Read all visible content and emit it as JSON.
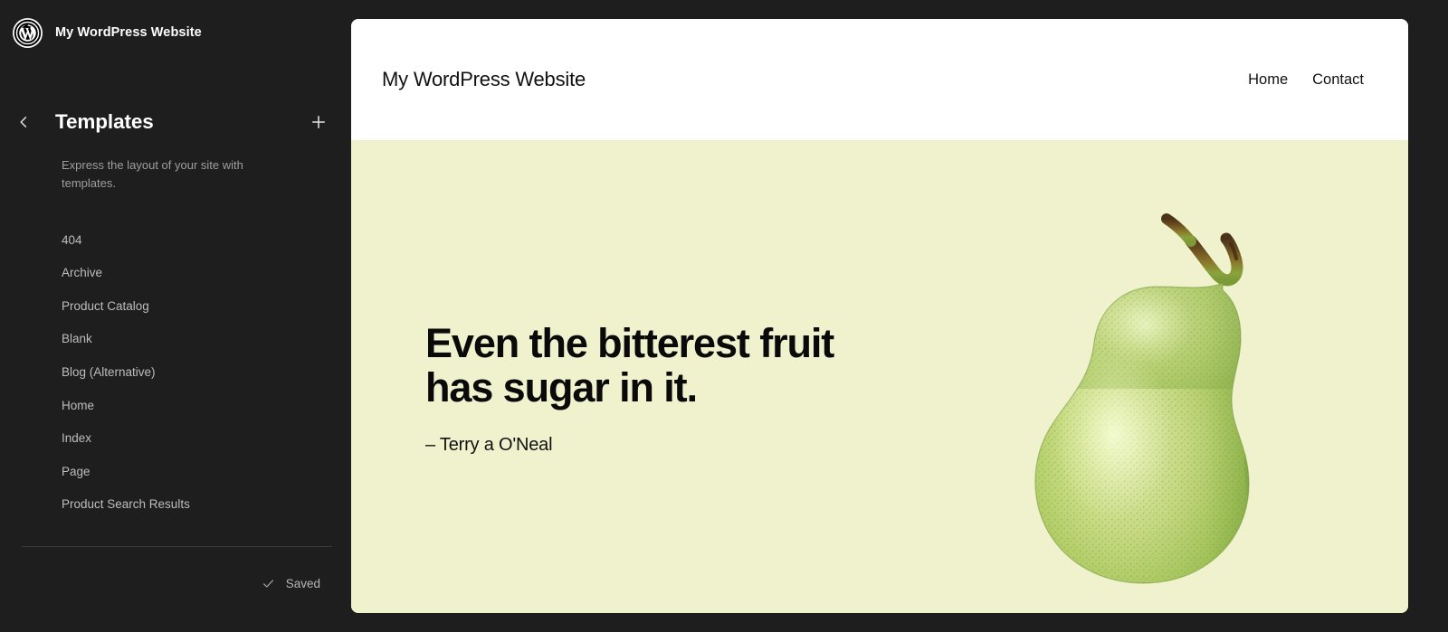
{
  "sidebar": {
    "site_hub": {
      "logo_icon": "wordpress-logo-icon",
      "title": "My WordPress Website"
    },
    "panel": {
      "back_icon": "chevron-left-icon",
      "title": "Templates",
      "add_icon": "plus-icon",
      "description": "Express the layout of your site with templates."
    },
    "templates": [
      {
        "label": "404"
      },
      {
        "label": "Archive"
      },
      {
        "label": "Product Catalog"
      },
      {
        "label": "Blank"
      },
      {
        "label": "Blog (Alternative)"
      },
      {
        "label": "Home"
      },
      {
        "label": "Index"
      },
      {
        "label": "Page"
      },
      {
        "label": "Product Search Results"
      }
    ],
    "save_status": {
      "icon": "check-icon",
      "label": "Saved"
    }
  },
  "canvas": {
    "site_header": {
      "site_title": "My WordPress Website",
      "nav": [
        {
          "label": "Home"
        },
        {
          "label": "Contact"
        }
      ]
    },
    "hero": {
      "quote": "Even the bitterest fruit has sugar in it.",
      "citation": "– Terry a O'Neal",
      "image_icon": "pear-illustration",
      "background_color": "#eff2cd"
    }
  },
  "colors": {
    "sidebar_background": "#1e1e1e",
    "canvas_background": "#ffffff",
    "hero_background": "#eff2cd",
    "sidebar_text": "#bdbdbd",
    "sidebar_heading": "#ffffff"
  }
}
